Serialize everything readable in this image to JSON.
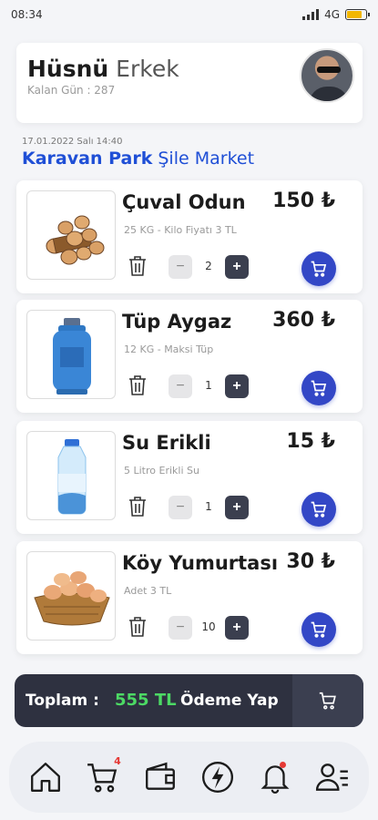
{
  "status": {
    "time": "08:34",
    "network": "4G",
    "battery_level": 0.8
  },
  "profile": {
    "first_name": "Hüsnü",
    "last_name": "Erkek",
    "remaining_days": "Kalan Gün : 287"
  },
  "order": {
    "date": "17.01.2022 Salı 14:40",
    "location_bold": "Karavan Park",
    "location_rest": "Şile Market"
  },
  "items": [
    {
      "title": "Çuval Odun",
      "subtitle": "25 KG - Kilo Fiyatı 3 TL",
      "price": "150 ₺",
      "quantity": "2"
    },
    {
      "title": "Tüp Aygaz",
      "subtitle": "12 KG - Maksi Tüp",
      "price": "360 ₺",
      "quantity": "1"
    },
    {
      "title": "Su Erikli",
      "subtitle": "5 Litro Erikli Su",
      "price": "15 ₺",
      "quantity": "1"
    },
    {
      "title": "Köy Yumurtası",
      "subtitle": "Adet 3 TL",
      "price": "30 ₺",
      "quantity": "10"
    }
  ],
  "controls": {
    "minus": "−",
    "plus": "+"
  },
  "total": {
    "label": "Toplam :",
    "value": "555 TL",
    "pay_label": "Ödeme Yap"
  },
  "nav": {
    "cart_badge": "4"
  },
  "colors": {
    "accent": "#3347c6",
    "total_green": "#4cd964",
    "dark_bar": "#2e3140",
    "badge_red": "#e53935"
  },
  "icons": [
    "home-icon",
    "shopping-cart-icon",
    "wallet-icon",
    "lightning-icon",
    "bell-icon",
    "user-list-icon",
    "trash-icon",
    "cart-icon"
  ]
}
